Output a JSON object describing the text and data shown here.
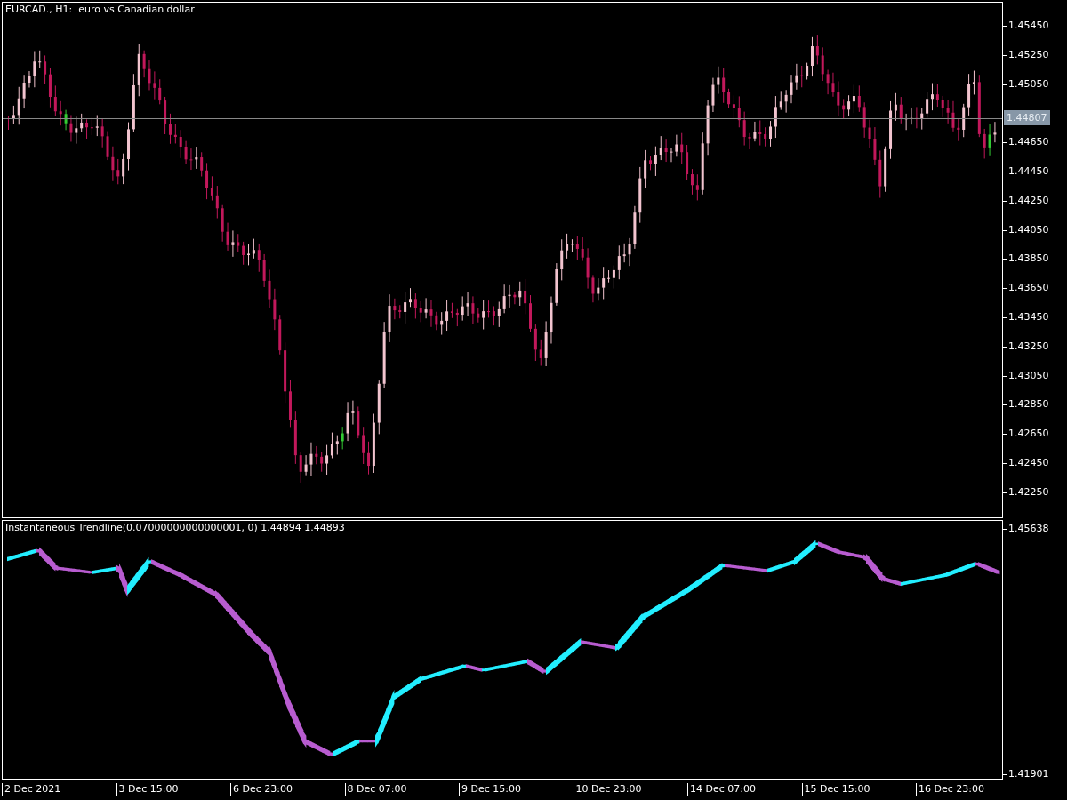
{
  "main_chart": {
    "title": "EURCAD., H1:  euro vs Canadian dollar",
    "price_labels": [
      "1.45450",
      "1.45250",
      "1.45050",
      "1.44650",
      "1.44450",
      "1.44250",
      "1.44050",
      "1.43850",
      "1.43650",
      "1.43450",
      "1.43250",
      "1.43050",
      "1.42850",
      "1.42650",
      "1.42450",
      "1.42250"
    ],
    "current_price": "1.44807"
  },
  "indicator": {
    "label": "Instantaneous Trendline(0.07000000000000001, 0) 1.44894 1.44893",
    "top_label": "1.45638",
    "bottom_label": "1.41901"
  },
  "time_labels": [
    "2 Dec 2021",
    "3 Dec 15:00",
    "6 Dec 23:00",
    "8 Dec 07:00",
    "9 Dec 15:00",
    "10 Dec 23:00",
    "14 Dec 07:00",
    "15 Dec 15:00",
    "16 Dec 23:00"
  ]
}
